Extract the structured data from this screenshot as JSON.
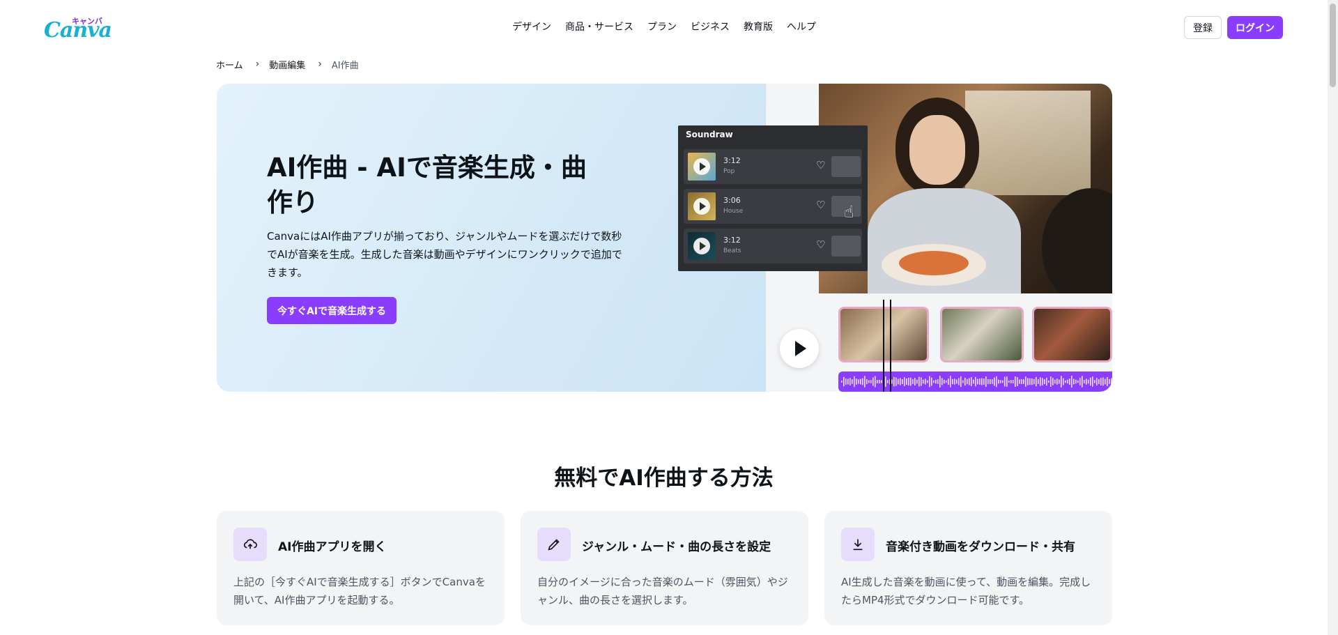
{
  "header": {
    "logo_text": "Canva",
    "logo_kana": "キャンバ",
    "nav": [
      "デザイン",
      "商品・サービス",
      "プラン",
      "ビジネス",
      "教育版",
      "ヘルプ"
    ],
    "register_label": "登録",
    "login_label": "ログイン"
  },
  "breadcrumb": {
    "items": [
      "ホーム",
      "動画編集",
      "AI作曲"
    ]
  },
  "hero": {
    "title": "AI作曲 - AIで音楽生成・曲作り",
    "description": "CanvaにはAI作曲アプリが揃っており、ジャンルやムードを選ぶだけで数秒でAIが音楽を生成。生成した音楽は動画やデザインにワンクリックで追加できます。",
    "cta_label": "今すぐAIで音楽生成する",
    "soundraw": {
      "title": "Soundraw",
      "tracks": [
        {
          "duration": "3:12",
          "genre": "Pop"
        },
        {
          "duration": "3:06",
          "genre": "House"
        },
        {
          "duration": "3:12",
          "genre": "Beats"
        }
      ]
    }
  },
  "section": {
    "title": "無料でAI作曲する方法",
    "cards": [
      {
        "title": "AI作曲アプリを開く",
        "desc": "上記の［今すぐAIで音楽生成する］ボタンでCanvaを開いて、AI作曲アプリを起動する。",
        "icon": "cloud-upload-icon"
      },
      {
        "title": "ジャンル・ムード・曲の長さを設定",
        "desc": "自分のイメージに合った音楽のムード（雰囲気）やジャンル、曲の長さを選択します。",
        "icon": "pencil-icon"
      },
      {
        "title": "音楽付き動画をダウンロード・共有",
        "desc": "AI生成した音楽を動画に使って、動画を編集。完成したらMP4形式でダウンロード可能です。",
        "icon": "download-icon"
      }
    ]
  },
  "colors": {
    "brand_purple": "#8b3dff",
    "hero_bg": "#d6ebf8",
    "card_bg": "#f3f4f6"
  }
}
